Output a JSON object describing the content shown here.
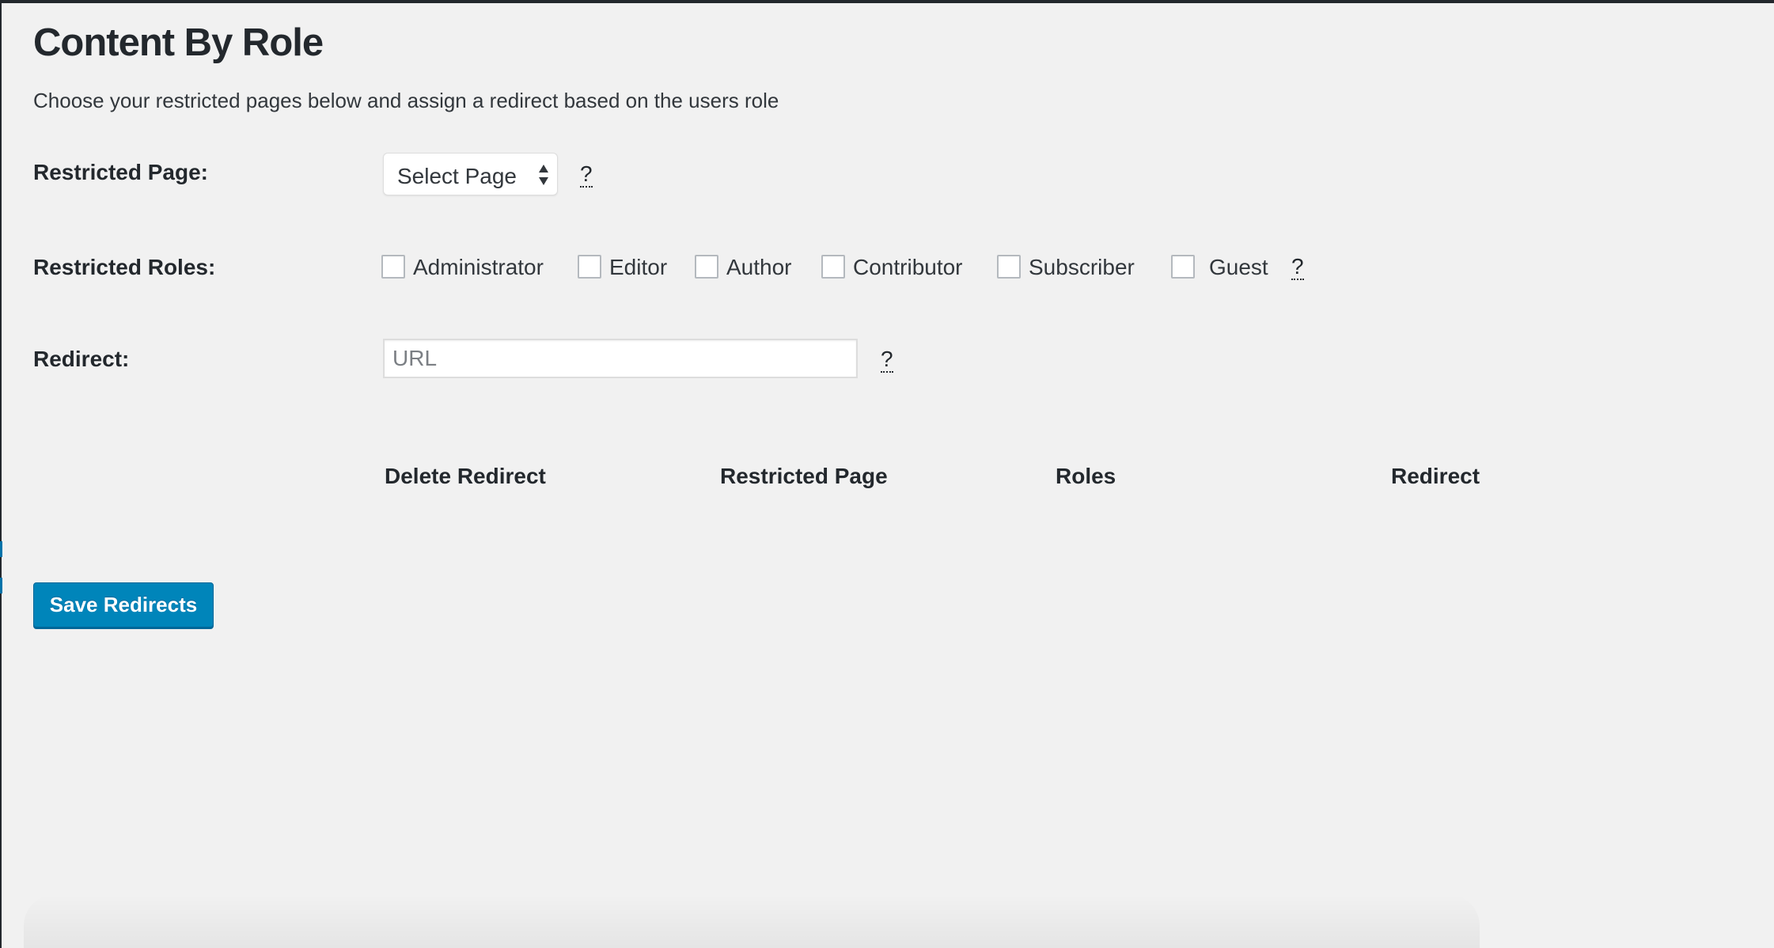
{
  "page": {
    "title": "Content By Role",
    "description": "Choose your restricted pages below and assign a redirect based on the users role"
  },
  "form": {
    "restricted_page": {
      "label": "Restricted Page:",
      "select_value": "Select Page",
      "help": "?"
    },
    "restricted_roles": {
      "label": "Restricted Roles:",
      "roles": [
        {
          "label": "Administrator",
          "checked": false
        },
        {
          "label": "Editor",
          "checked": false
        },
        {
          "label": "Author",
          "checked": false
        },
        {
          "label": "Contributor",
          "checked": false
        },
        {
          "label": "Subscriber",
          "checked": false
        },
        {
          "label": "Guest",
          "checked": false
        }
      ],
      "help": "?"
    },
    "redirect": {
      "label": "Redirect:",
      "placeholder": "URL",
      "value": "",
      "help": "?"
    }
  },
  "table": {
    "headers": [
      "Delete Redirect",
      "Restricted Page",
      "Roles",
      "Redirect"
    ],
    "rows": []
  },
  "actions": {
    "save_label": "Save Redirects"
  },
  "colors": {
    "background": "#f1f1f1",
    "text": "#23282d",
    "primary_button": "#0085ba",
    "admin_bar": "#23282d"
  },
  "icons": {
    "select_arrows": "up-down-arrows-icon"
  }
}
